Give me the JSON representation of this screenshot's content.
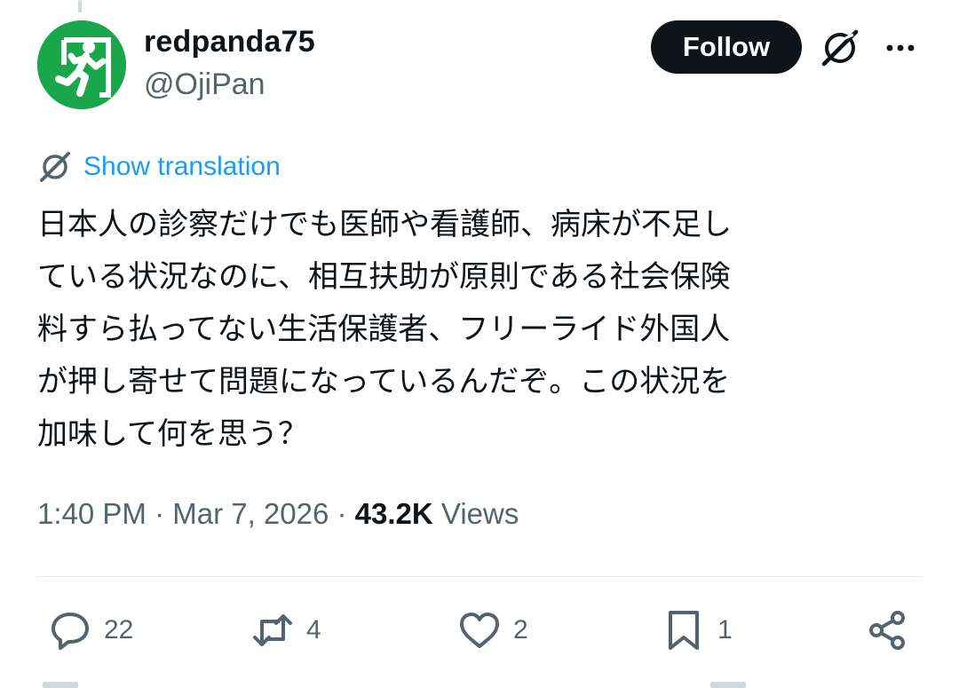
{
  "author": {
    "display_name": "redpanda75",
    "handle": "@OjiPan",
    "avatar_icon": "emergency-exit-running-man-icon"
  },
  "header": {
    "follow_label": "Follow"
  },
  "translation": {
    "link_label": "Show translation"
  },
  "tweet": {
    "text": "日本人の診察だけでも医師や看護師、病床が不足し\nている状況なのに、相互扶助が原則である社会保険\n料すら払ってない生活保護者、フリーライド外国人\nが押し寄せて問題になっているんだぞ。この状況を\n加味して何を思う？"
  },
  "meta": {
    "time": "1:40 PM",
    "separator1": " · ",
    "date": "Mar 7, 2026",
    "separator2": " · ",
    "views_count": "43.2K",
    "views_label": " Views"
  },
  "actions": {
    "replies": "22",
    "reposts": "4",
    "likes": "2",
    "bookmarks": "1"
  },
  "colors": {
    "accent": "#1d9bf0",
    "text": "#0f1419",
    "muted": "#536471",
    "avatar_green": "#1aa64a"
  }
}
